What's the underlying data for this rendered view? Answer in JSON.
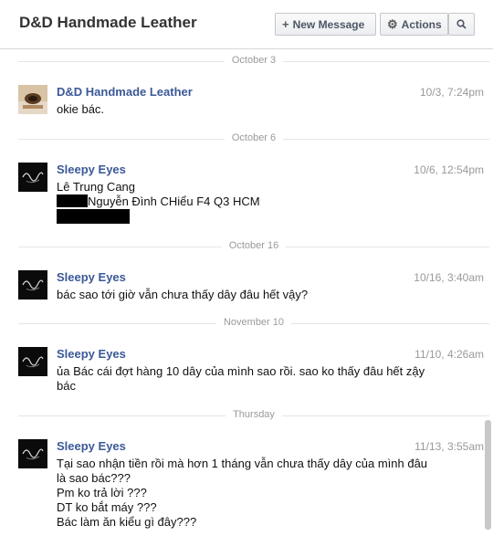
{
  "header": {
    "title": "D&D Handmade Leather",
    "new_message_label": "New Message",
    "actions_label": "Actions",
    "new_message_icon": "plus-icon",
    "actions_icon": "gear-icon",
    "search_icon": "search-icon"
  },
  "thread": {
    "dividers": [
      "October 3",
      "October 6",
      "October 16",
      "November 10",
      "Thursday"
    ],
    "messages": [
      {
        "sender": "D&D Handmade Leather",
        "time": "10/3, 7:24pm",
        "lines": [
          "okie bác."
        ]
      },
      {
        "sender": "Sleepy Eyes",
        "time": "10/6, 12:54pm",
        "lines": [
          "Lê Trung Cang",
          "Nguyễn Đình CHiểu F4 Q3 HCM"
        ]
      },
      {
        "sender": "Sleepy Eyes",
        "time": "10/16, 3:40am",
        "lines": [
          "bác sao tới giờ vẫn chưa thấy dây đâu hết vậy?"
        ]
      },
      {
        "sender": "Sleepy Eyes",
        "time": "11/10, 4:26am",
        "lines": [
          "ủa Bác cái đợt hàng 10 dây của mình sao rồi. sao ko thấy đâu hết zậy",
          "bác"
        ]
      },
      {
        "sender": "Sleepy Eyes",
        "time": "11/13, 3:55am",
        "lines": [
          "Tại sao nhận tiền rồi mà hơn 1 tháng vẫn chưa thấy dây của mình đâu",
          "là sao bác???",
          "Pm ko trả lời ???",
          "DT ko bắt máy ???",
          "Bác làm ăn kiểu gì đây???"
        ]
      }
    ]
  }
}
